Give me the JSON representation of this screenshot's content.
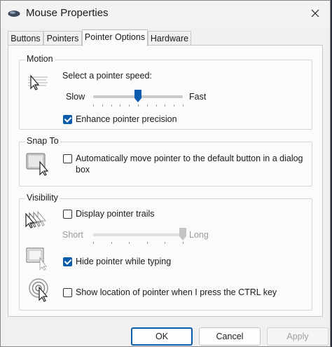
{
  "window": {
    "title": "Mouse Properties"
  },
  "tabs": [
    {
      "label": "Buttons"
    },
    {
      "label": "Pointers"
    },
    {
      "label": "Pointer Options",
      "active": true
    },
    {
      "label": "Hardware"
    }
  ],
  "motion": {
    "legend": "Motion",
    "speed_label": "Select a pointer speed:",
    "slow_label": "Slow",
    "fast_label": "Fast",
    "speed_value": 10,
    "speed_max": 20,
    "enhance_label": "Enhance pointer precision",
    "enhance_checked": true
  },
  "snap": {
    "legend": "Snap To",
    "auto_label_line1": "Automatically move pointer to the default button in a dialog",
    "auto_label_line2": "box",
    "auto_checked": false
  },
  "visibility": {
    "legend": "Visibility",
    "trails_label": "Display pointer trails",
    "trails_checked": false,
    "short_label": "Short",
    "long_label": "Long",
    "trails_value": 10,
    "trails_max": 10,
    "hide_label": "Hide pointer while typing",
    "hide_checked": true,
    "show_ctrl_label": "Show location of pointer when I press the CTRL key",
    "show_ctrl_checked": false
  },
  "buttons": {
    "ok": "OK",
    "cancel": "Cancel",
    "apply": "Apply"
  },
  "colors": {
    "accent": "#0b5cad",
    "panel": "#fbfbfb",
    "window": "#f0f0f0"
  },
  "icons": {
    "app": "mouse-icon",
    "close": "close-icon",
    "speed": "pointer-speed-icon",
    "snap": "snap-to-dialog-icon",
    "trails": "pointer-trails-icon",
    "hide": "hide-pointer-icon",
    "ctrl": "pointer-location-icon"
  }
}
